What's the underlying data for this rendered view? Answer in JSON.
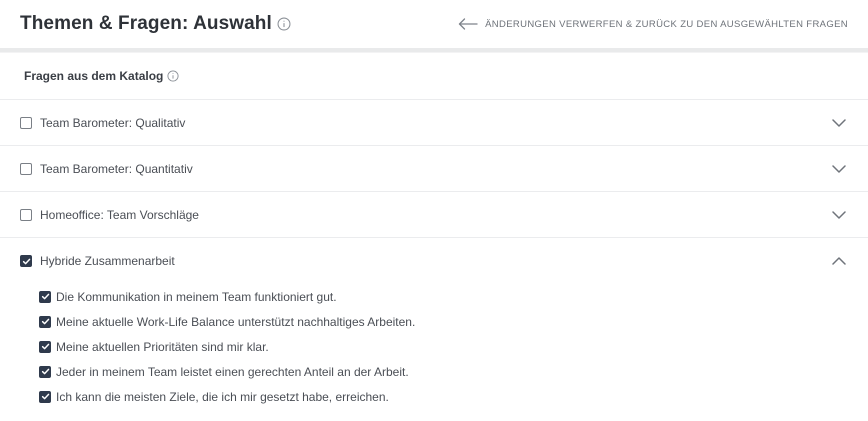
{
  "header": {
    "title": "Themen & Fragen: Auswahl",
    "back_label": "Änderungen verwerfen & zurück zu den ausgewählten Fragen"
  },
  "catalog": {
    "label": "Fragen aus dem Katalog"
  },
  "groups": [
    {
      "label": "Team Barometer: Qualitativ",
      "checked": false,
      "expanded": false
    },
    {
      "label": "Team Barometer: Quantitativ",
      "checked": false,
      "expanded": false
    },
    {
      "label": "Homeoffice: Team Vorschläge",
      "checked": false,
      "expanded": false
    },
    {
      "label": "Hybride Zusammenarbeit",
      "checked": true,
      "expanded": true
    }
  ],
  "questions": [
    {
      "label": "Die Kommunikation in meinem Team funktioniert gut.",
      "checked": true
    },
    {
      "label": "Meine aktuelle Work-Life Balance unterstützt nachhaltiges Arbeiten.",
      "checked": true
    },
    {
      "label": "Meine aktuellen Prioritäten sind mir klar.",
      "checked": true
    },
    {
      "label": "Jeder in meinem Team leistet einen gerechten Anteil an der Arbeit.",
      "checked": true
    },
    {
      "label": "Ich kann die meisten Ziele, die ich mir gesetzt habe, erreichen.",
      "checked": true
    }
  ],
  "icons": {
    "info": "info-icon",
    "back": "arrow-left-icon",
    "collapsed": "chevron-down-icon",
    "expanded": "chevron-up-icon",
    "checkmark": "checkmark-icon"
  },
  "colors": {
    "checkbox_checked": "#2f3a4c",
    "divider": "#e9eaeb"
  }
}
